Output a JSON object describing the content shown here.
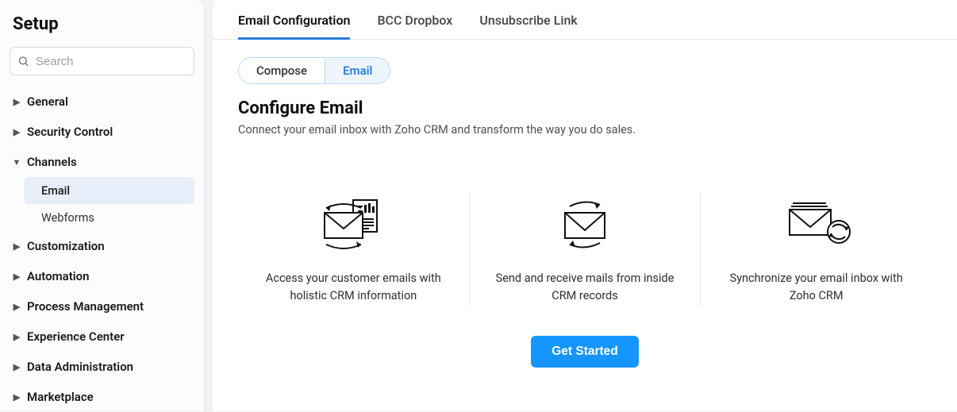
{
  "sidebar": {
    "title": "Setup",
    "search_placeholder": "Search",
    "items": [
      {
        "label": "General",
        "expanded": false
      },
      {
        "label": "Security Control",
        "expanded": false
      },
      {
        "label": "Channels",
        "expanded": true,
        "children": [
          {
            "label": "Email",
            "active": true
          },
          {
            "label": "Webforms",
            "active": false
          }
        ]
      },
      {
        "label": "Customization",
        "expanded": false
      },
      {
        "label": "Automation",
        "expanded": false
      },
      {
        "label": "Process Management",
        "expanded": false
      },
      {
        "label": "Experience Center",
        "expanded": false
      },
      {
        "label": "Data Administration",
        "expanded": false
      },
      {
        "label": "Marketplace",
        "expanded": false
      }
    ]
  },
  "tabs": [
    {
      "label": "Email Configuration",
      "active": true
    },
    {
      "label": "BCC Dropbox",
      "active": false
    },
    {
      "label": "Unsubscribe Link",
      "active": false
    }
  ],
  "pills": {
    "compose": "Compose",
    "email": "Email"
  },
  "heading": "Configure Email",
  "subheading": "Connect your email inbox with Zoho CRM and transform the way you do sales.",
  "features": [
    {
      "text": "Access your customer emails with holistic CRM information",
      "icon": "envelope-report"
    },
    {
      "text": "Send and receive mails from inside CRM records",
      "icon": "envelope-sendreceive"
    },
    {
      "text": "Synchronize your email inbox with Zoho CRM",
      "icon": "envelope-sync"
    }
  ],
  "cta": "Get Started"
}
